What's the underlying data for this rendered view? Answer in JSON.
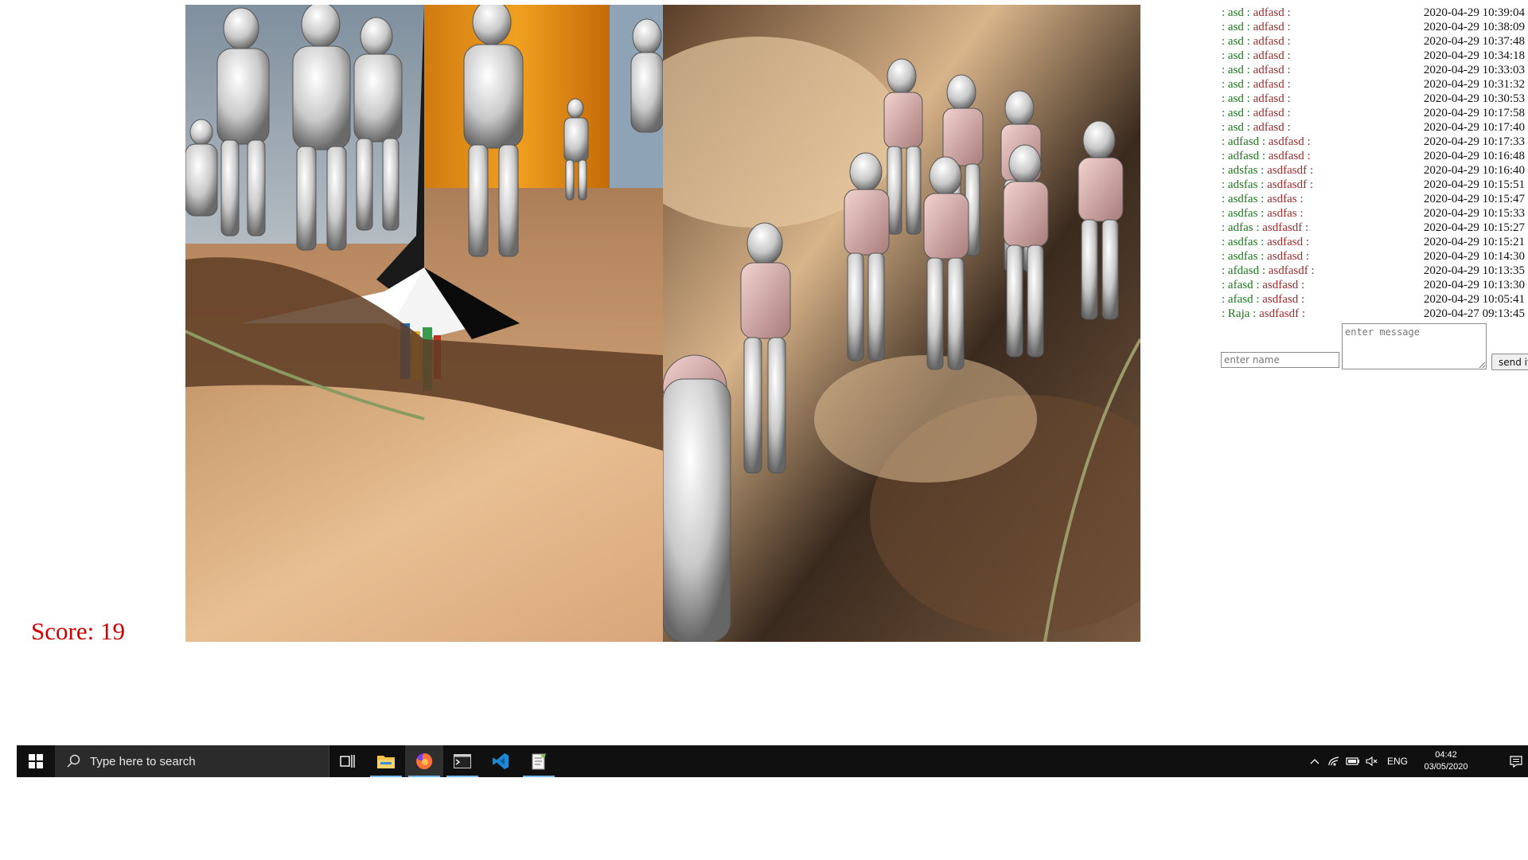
{
  "score": {
    "label": "Score:",
    "value": "19"
  },
  "chat": {
    "messages": [
      {
        "name": "asd",
        "text": "adfasd",
        "time": "2020-04-29 10:39:04"
      },
      {
        "name": "asd",
        "text": "adfasd",
        "time": "2020-04-29 10:38:09"
      },
      {
        "name": "asd",
        "text": "adfasd",
        "time": "2020-04-29 10:37:48"
      },
      {
        "name": "asd",
        "text": "adfasd",
        "time": "2020-04-29 10:34:18"
      },
      {
        "name": "asd",
        "text": "adfasd",
        "time": "2020-04-29 10:33:03"
      },
      {
        "name": "asd",
        "text": "adfasd",
        "time": "2020-04-29 10:31:32"
      },
      {
        "name": "asd",
        "text": "adfasd",
        "time": "2020-04-29 10:30:53"
      },
      {
        "name": "asd",
        "text": "adfasd",
        "time": "2020-04-29 10:17:58"
      },
      {
        "name": "asd",
        "text": "adfasd",
        "time": "2020-04-29 10:17:40"
      },
      {
        "name": "adfasd",
        "text": "asdfasd",
        "time": "2020-04-29 10:17:33"
      },
      {
        "name": "adfasd",
        "text": "asdfasd",
        "time": "2020-04-29 10:16:48"
      },
      {
        "name": "adsfas",
        "text": "asdfasdf",
        "time": "2020-04-29 10:16:40"
      },
      {
        "name": "adsfas",
        "text": "asdfasdf",
        "time": "2020-04-29 10:15:51"
      },
      {
        "name": "asdfas",
        "text": "asdfas",
        "time": "2020-04-29 10:15:47"
      },
      {
        "name": "asdfas",
        "text": "asdfas",
        "time": "2020-04-29 10:15:33"
      },
      {
        "name": "adfas",
        "text": "asdfasdf",
        "time": "2020-04-29 10:15:27"
      },
      {
        "name": "asdfas",
        "text": "asdfasd",
        "time": "2020-04-29 10:15:21"
      },
      {
        "name": "asdfas",
        "text": "asdfasd",
        "time": "2020-04-29 10:14:30"
      },
      {
        "name": "afdasd",
        "text": "asdfasdf",
        "time": "2020-04-29 10:13:35"
      },
      {
        "name": "afasd",
        "text": "asdfasd",
        "time": "2020-04-29 10:13:30"
      },
      {
        "name": "afasd",
        "text": "asdfasd",
        "time": "2020-04-29 10:05:41"
      },
      {
        "name": "Raja",
        "text": "asdfasdf",
        "time": "2020-04-27 09:13:45"
      }
    ],
    "name_placeholder": "enter name",
    "message_placeholder": "enter message",
    "send_label": "send it"
  },
  "taskbar": {
    "search_placeholder": "Type here to search",
    "language": "ENG",
    "time": "04:42",
    "date": "03/05/2020",
    "apps": [
      {
        "icon": "task-view-icon"
      },
      {
        "icon": "file-explorer-icon"
      },
      {
        "icon": "firefox-icon"
      },
      {
        "icon": "terminal-icon"
      },
      {
        "icon": "vscode-icon"
      },
      {
        "icon": "notepad-plus-plus-icon"
      }
    ]
  },
  "colors": {
    "score": "#d00000",
    "chat_name": "#1a7a1a",
    "chat_text": "#9b2c2c",
    "taskbar_bg": "#101010",
    "taskbar_indicator": "#76b9ed"
  }
}
